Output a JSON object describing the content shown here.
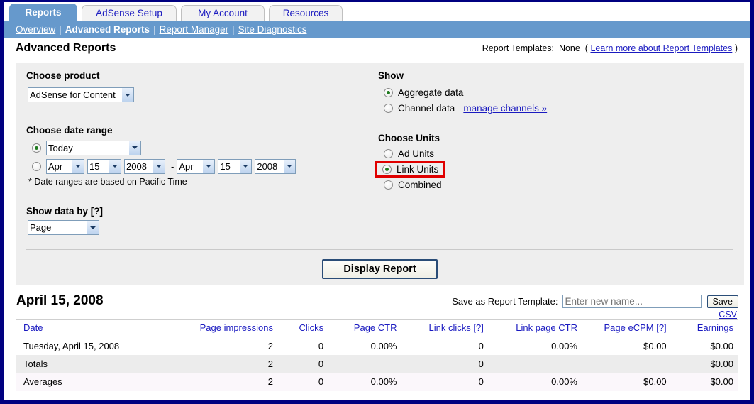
{
  "tabs": [
    {
      "label": "Reports",
      "active": true
    },
    {
      "label": "AdSense Setup",
      "active": false
    },
    {
      "label": "My Account",
      "active": false
    },
    {
      "label": "Resources",
      "active": false
    }
  ],
  "nav": {
    "items": [
      {
        "label": "Overview",
        "current": false
      },
      {
        "label": "Advanced Reports",
        "current": true
      },
      {
        "label": "Report Manager",
        "current": false
      },
      {
        "label": "Site Diagnostics",
        "current": false
      }
    ],
    "separator": "|"
  },
  "page": {
    "title": "Advanced Reports",
    "templates_label": "Report Templates:",
    "templates_value": "None",
    "templates_open_paren": "(",
    "templates_link": "Learn more about Report Templates",
    "templates_close_paren": ")"
  },
  "choose_product": {
    "label": "Choose product",
    "selected": "AdSense for Content"
  },
  "date_range": {
    "label": "Choose date range",
    "preset_selected": "Today",
    "preset_checked": true,
    "custom_checked": false,
    "start_month": "Apr",
    "start_day": "15",
    "start_year": "2008",
    "dash": "-",
    "end_month": "Apr",
    "end_day": "15",
    "end_year": "2008",
    "note": "* Date ranges are based on Pacific Time"
  },
  "show_data_by": {
    "label": "Show data by [?]",
    "selected": "Page"
  },
  "show": {
    "label": "Show",
    "options": [
      {
        "label": "Aggregate data",
        "checked": true
      },
      {
        "label": "Channel data",
        "checked": false
      }
    ],
    "manage_channels_link": "manage channels »"
  },
  "choose_units": {
    "label": "Choose Units",
    "options": [
      {
        "label": "Ad Units",
        "checked": false,
        "highlighted": false
      },
      {
        "label": "Link Units",
        "checked": true,
        "highlighted": true
      },
      {
        "label": "Combined",
        "checked": false,
        "highlighted": false
      }
    ],
    "highlight_color": "#e00000"
  },
  "display_report_button": "Display Report",
  "report": {
    "date_heading": "April 15, 2008",
    "save_label": "Save as Report Template:",
    "template_name_value": "",
    "template_name_placeholder": "Enter new name...",
    "save_button": "Save",
    "csv_link": "CSV",
    "columns": [
      "Date",
      "Page impressions",
      "Clicks",
      "Page CTR",
      "Link clicks [?]",
      "Link page CTR",
      "Page eCPM [?]",
      "Earnings"
    ],
    "rows": [
      [
        "Tuesday, April 15, 2008",
        "2",
        "0",
        "0.00%",
        "0",
        "0.00%",
        "$0.00",
        "$0.00"
      ],
      [
        "Totals",
        "2",
        "0",
        "",
        "0",
        "",
        "",
        "$0.00"
      ],
      [
        "Averages",
        "2",
        "0",
        "0.00%",
        "0",
        "0.00%",
        "$0.00",
        "$0.00"
      ]
    ]
  }
}
